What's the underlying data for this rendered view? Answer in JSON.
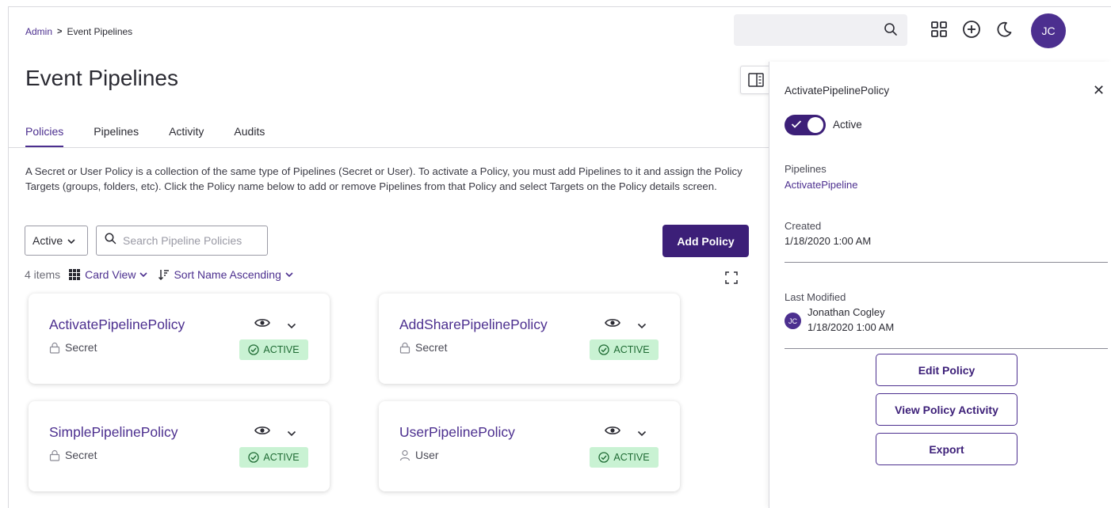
{
  "breadcrumb": {
    "parent": "Admin",
    "current": "Event Pipelines"
  },
  "header": {
    "user_initials": "JC"
  },
  "page": {
    "title": "Event Pipelines"
  },
  "tabs": [
    {
      "label": "Policies",
      "active": true
    },
    {
      "label": "Pipelines",
      "active": false
    },
    {
      "label": "Activity",
      "active": false
    },
    {
      "label": "Audits",
      "active": false
    }
  ],
  "description": "A Secret or User Policy is a collection of the same type of Pipelines (Secret or User). To activate a Policy, you must add Pipelines to it and assign the Policy Targets (groups, folders, etc). Click the Policy name below to add or remove Pipelines from that Policy and select Targets on the Policy details screen.",
  "filters": {
    "status_value": "Active",
    "search_placeholder": "Search Pipeline Policies",
    "add_button": "Add Policy"
  },
  "toolbar": {
    "count": "4 items",
    "view": "Card View",
    "sort": "Sort Name Ascending"
  },
  "cards": [
    {
      "name": "ActivatePipelinePolicy",
      "type": "Secret",
      "type_icon": "lock-icon",
      "status": "ACTIVE"
    },
    {
      "name": "AddSharePipelinePolicy",
      "type": "Secret",
      "type_icon": "lock-icon",
      "status": "ACTIVE"
    },
    {
      "name": "SimplePipelinePolicy",
      "type": "Secret",
      "type_icon": "lock-icon",
      "status": "ACTIVE"
    },
    {
      "name": "UserPipelinePolicy",
      "type": "User",
      "type_icon": "user-icon",
      "status": "ACTIVE"
    }
  ],
  "detail_panel": {
    "title": "ActivatePipelinePolicy",
    "toggle_label": "Active",
    "pipelines_label": "Pipelines",
    "pipeline_name": "ActivatePipeline",
    "created_label": "Created",
    "created_value": "1/18/2020 1:00 AM",
    "modified_label": "Last Modified",
    "modified_by": "Jonathan Cogley",
    "modified_initials": "JC",
    "modified_value": "1/18/2020 1:00 AM",
    "buttons": {
      "edit": "Edit Policy",
      "activity": "View Policy Activity",
      "export": "Export"
    }
  },
  "colors": {
    "primary": "#3c1f78",
    "link": "#4c2f8f",
    "badge_bg": "#c9f2d3",
    "badge_text": "#1f6b34"
  }
}
